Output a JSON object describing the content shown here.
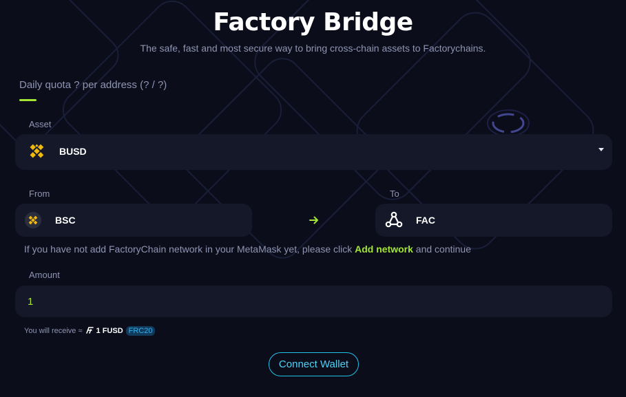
{
  "header": {
    "title": "Factory Bridge",
    "subtitle": "The safe, fast and most secure way to bring cross-chain assets to Factorychains."
  },
  "quota": {
    "text": "Daily quota ? per address (? / ?)"
  },
  "asset": {
    "label": "Asset",
    "value": "BUSD",
    "icon": "busd-icon"
  },
  "from": {
    "label": "From",
    "value": "BSC",
    "icon": "bsc-icon"
  },
  "to": {
    "label": "To",
    "value": "FAC",
    "icon": "fac-icon"
  },
  "notice": {
    "before": "If you have not add FactoryChain network in your MetaMask yet, please click",
    "link": "Add network",
    "after": "and continue"
  },
  "amount": {
    "label": "Amount",
    "value": "1"
  },
  "receive": {
    "prefix": "You will receive ≈",
    "value": "1 FUSD",
    "badge": "FRC20"
  },
  "connect": {
    "label": "Connect Wallet"
  },
  "colors": {
    "accent": "#a3e635",
    "cyan": "#22c3e6",
    "background": "#0b0d1b",
    "field": "#141829",
    "binance": "#f0b90b"
  }
}
